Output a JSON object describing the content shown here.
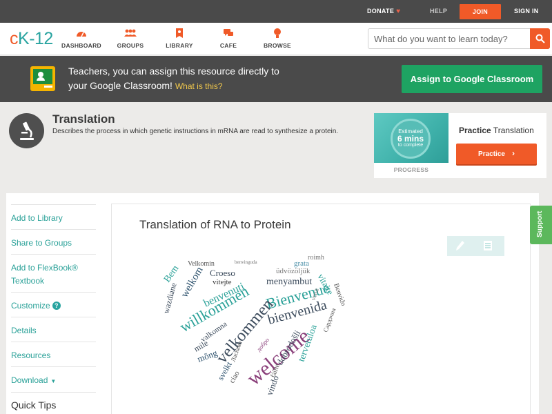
{
  "topbar": {
    "donate": "DONATE",
    "help": "HELP",
    "join": "JOIN",
    "signin": "SIGN IN"
  },
  "nav": {
    "logo": {
      "c": "c",
      "k": "K",
      "n": "-12"
    },
    "items": [
      {
        "label": "DASHBOARD",
        "icon": "dashboard-icon"
      },
      {
        "label": "GROUPS",
        "icon": "groups-icon"
      },
      {
        "label": "LIBRARY",
        "icon": "library-icon"
      },
      {
        "label": "CAFE",
        "icon": "cafe-icon"
      },
      {
        "label": "BROWSE",
        "icon": "browse-icon"
      }
    ],
    "search_placeholder": "What do you want to learn today?"
  },
  "classroom": {
    "line1": "Teachers, you can assign this resource directly to",
    "line2": "your Google Classroom!",
    "what": "What is this?",
    "button": "Assign to Google Classroom"
  },
  "concept": {
    "title": "Translation",
    "description": "Describes the process in which genetic instructions in mRNA are read to synthesize a protein."
  },
  "practice": {
    "estimated": "Estimated",
    "mins": "6 mins",
    "to_complete": "to complete",
    "progress": "PROGRESS",
    "heading_bold": "Practice",
    "heading_rest": "Translation",
    "button": "Practice"
  },
  "sidebar": {
    "items": [
      {
        "label": "Add to Library"
      },
      {
        "label": "Share to Groups"
      },
      {
        "label": "Add to FlexBook® Textbook"
      },
      {
        "label": "Customize"
      },
      {
        "label": "Details"
      },
      {
        "label": "Resources"
      },
      {
        "label": "Download"
      }
    ],
    "quick_tips": "Quick Tips"
  },
  "main": {
    "card_title": "Translation of RNA to Protein"
  },
  "support": "Support",
  "colors": {
    "brand_orange": "#f05a28",
    "brand_teal": "#29a4a0",
    "classroom_green": "#1ea362",
    "dark_bar": "#4a4a4a"
  }
}
